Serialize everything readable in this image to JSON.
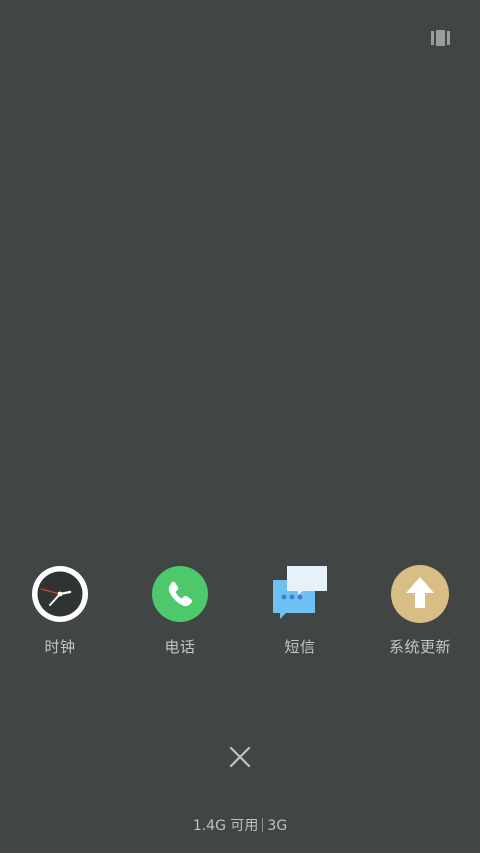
{
  "header": {
    "menu_icon": "grid-toggle-icon"
  },
  "apps": [
    {
      "label": "时钟",
      "icon": "clock-icon"
    },
    {
      "label": "电话",
      "icon": "phone-icon",
      "color": "#4dc96c"
    },
    {
      "label": "短信",
      "icon": "message-icon",
      "color": "#6ec1f2"
    },
    {
      "label": "系统更新",
      "icon": "system-update-icon",
      "color": "#d8bd84"
    }
  ],
  "footer": {
    "close_icon": "close-icon",
    "memory_available": "1.4G 可用",
    "network": "3G"
  }
}
